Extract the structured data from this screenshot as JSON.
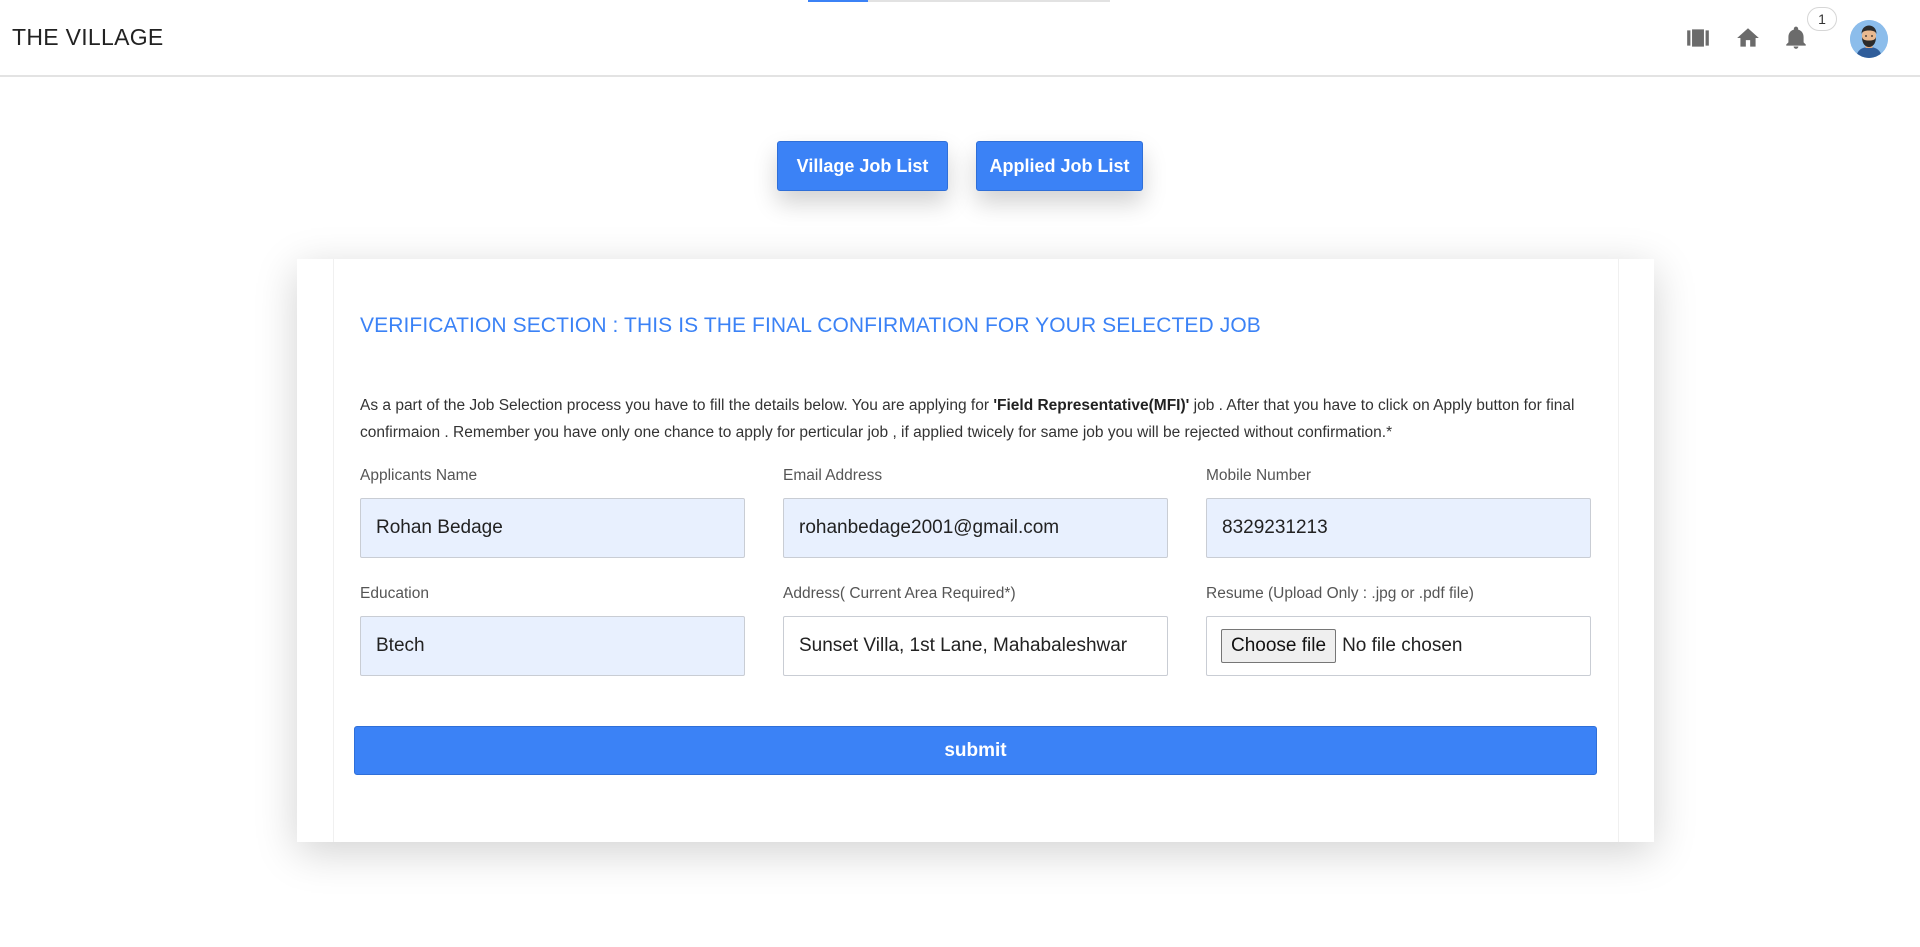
{
  "nav": {
    "brand": "THE VILLAGE",
    "notification_count": "1",
    "icons": [
      "book-icon",
      "home-icon",
      "bell-icon"
    ],
    "progress": 0.2
  },
  "top_buttons": {
    "village_job_list": "Village Job List",
    "applied_job_list": "Applied Job List"
  },
  "card": {
    "title": "VERIFICATION SECTION : THIS IS THE FINAL CONFIRMATION FOR YOUR SELECTED JOB",
    "desc_prefix": "As a part of the Job Selection process you have to fill the details below. You are applying for ",
    "job_name": "'Field Representative(MFI)'",
    "desc_suffix": " job . After that you have to click on Apply button for final confirmaion . Remember you have only one chance to apply for perticular job , if applied twicely for same job you will be rejected without confirmation.*"
  },
  "form": {
    "name": {
      "label": "Applicants Name",
      "value": "Rohan Bedage"
    },
    "email": {
      "label": "Email Address",
      "value": "rohanbedage2001@gmail.com"
    },
    "mobile": {
      "label": "Mobile Number",
      "value": "8329231213"
    },
    "education": {
      "label": "Education",
      "value": "Btech"
    },
    "address": {
      "label": "Address( Current Area Required*)",
      "value": "Sunset Villa, 1st Lane, Mahabaleshwar"
    },
    "resume": {
      "label": "Resume (Upload Only : .jpg or .pdf file)",
      "button": "Choose file",
      "status": "No file chosen"
    },
    "submit": "submit"
  },
  "colors": {
    "accent": "#3b82f6",
    "autofill_bg": "#e8f0fe"
  }
}
